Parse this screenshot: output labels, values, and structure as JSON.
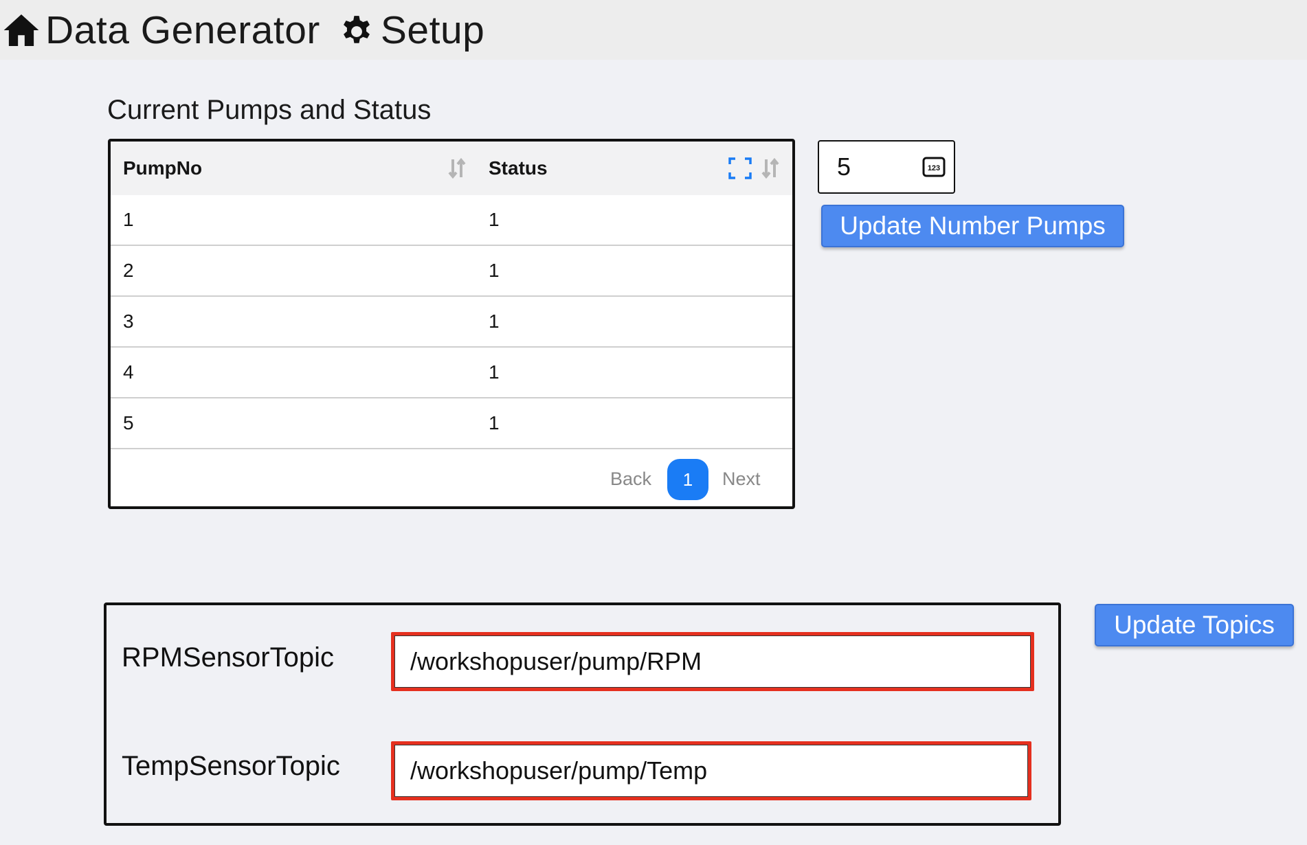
{
  "nav": {
    "home_label": "Data Generator",
    "home_icon": "home-icon",
    "setup_label": "Setup",
    "setup_icon": "gear-icon"
  },
  "pumps_section": {
    "title": "Current Pumps and Status",
    "columns": [
      "PumpNo",
      "Status"
    ],
    "rows": [
      {
        "pump_no": "1",
        "status": "1"
      },
      {
        "pump_no": "2",
        "status": "1"
      },
      {
        "pump_no": "3",
        "status": "1"
      },
      {
        "pump_no": "4",
        "status": "1"
      },
      {
        "pump_no": "5",
        "status": "1"
      }
    ],
    "pager": {
      "back_label": "Back",
      "current_page": "1",
      "next_label": "Next"
    }
  },
  "number_pumps": {
    "value": "5",
    "icon": "numeric-123-icon",
    "button_label": "Update Number Pumps"
  },
  "topics": {
    "rpm_label": "RPMSensorTopic",
    "rpm_value": "/workshopuser/pump/RPM",
    "temp_label": "TempSensorTopic",
    "temp_value": "/workshopuser/pump/Temp",
    "button_label": "Update Topics"
  },
  "colors": {
    "accent_button": "#4d8af0",
    "pager_active": "#1a7cf5",
    "field_highlight": "#e5301f"
  }
}
